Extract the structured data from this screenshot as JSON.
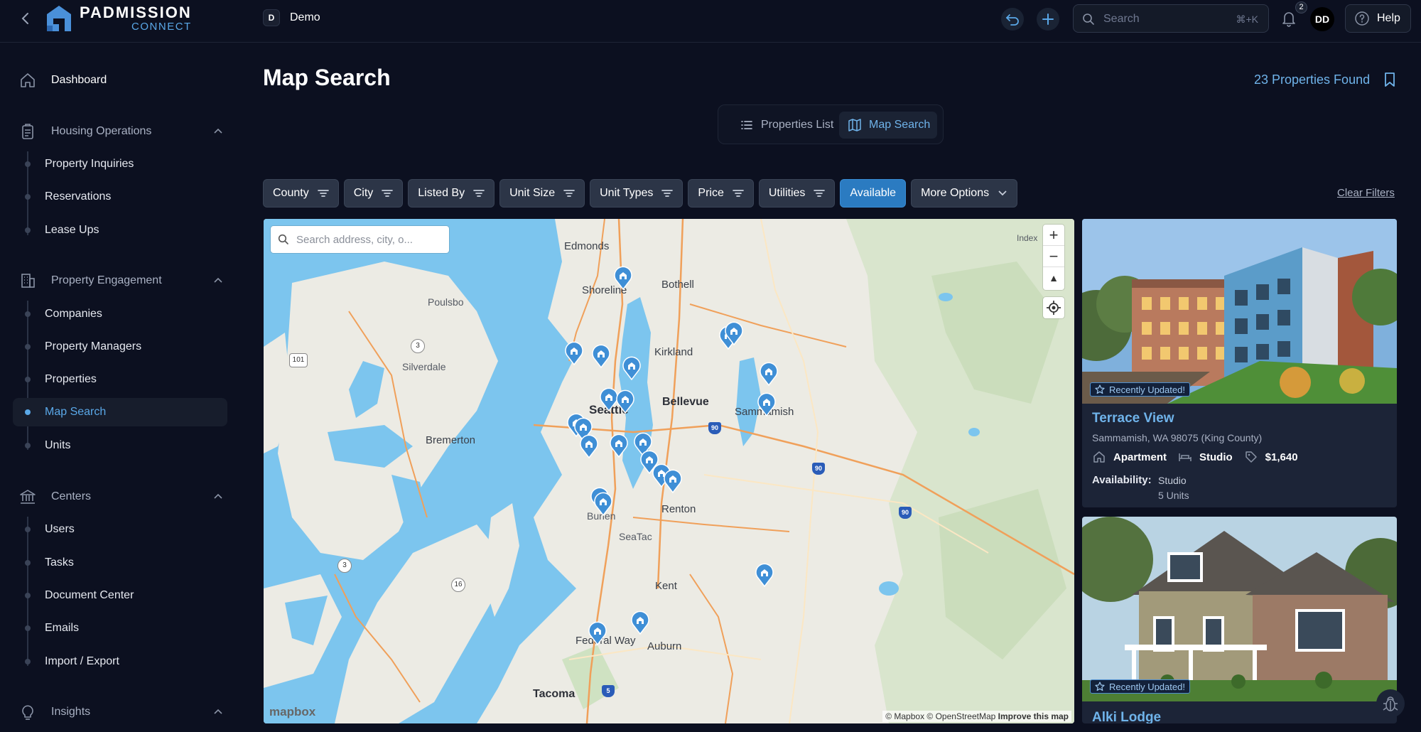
{
  "header": {
    "logo_title": "PADMISSION",
    "logo_subtitle": "CONNECT",
    "org_initial": "D",
    "org_name": "Demo",
    "search_placeholder": "Search",
    "search_shortcut": "⌘+K",
    "notification_count": "2",
    "avatar_initials": "DD",
    "help_label": "Help"
  },
  "sidebar": {
    "dashboard": "Dashboard",
    "sections": [
      {
        "label": "Housing Operations",
        "items": [
          "Property Inquiries",
          "Reservations",
          "Lease Ups"
        ]
      },
      {
        "label": "Property Engagement",
        "items": [
          "Companies",
          "Property Managers",
          "Properties",
          "Map Search",
          "Units"
        ]
      },
      {
        "label": "Centers",
        "items": [
          "Users",
          "Tasks",
          "Document Center",
          "Emails",
          "Import / Export"
        ]
      },
      {
        "label": "Insights",
        "items": []
      }
    ],
    "active_item": "Map Search"
  },
  "main": {
    "title": "Map Search",
    "properties_found": "23 Properties Found",
    "view_toggle": {
      "list": "Properties List",
      "map": "Map Search",
      "selected": "Map Search"
    },
    "filters": [
      "County",
      "City",
      "Listed By",
      "Unit Size",
      "Unit Types",
      "Price",
      "Utilities"
    ],
    "available_filter": "Available",
    "more_options": "More Options",
    "clear_filters": "Clear Filters"
  },
  "map": {
    "search_placeholder": "Search address, city, o...",
    "places": {
      "edmonds": "Edmonds",
      "shoreline": "Shoreline",
      "bothell": "Bothell",
      "poulsbo": "Poulsbo",
      "kirkland": "Kirkland",
      "silverdale": "Silverdale",
      "seattle": "Seattle",
      "bellevue": "Bellevue",
      "sammamish": "Sammamish",
      "bremerton": "Bremerton",
      "renton": "Renton",
      "burien": "Burien",
      "seatac": "SeaTac",
      "kent": "Kent",
      "federal_way": "Federal Way",
      "auburn": "Auburn",
      "tacoma": "Tacoma",
      "index": "Index"
    },
    "highways": {
      "sr3a": "3",
      "sr3b": "3",
      "us101": "101",
      "sr16": "16",
      "i90a": "90",
      "i90b": "90",
      "i90c": "90",
      "i5": "5"
    },
    "logo": "mapbox",
    "attribution": "© Mapbox © OpenStreetMap",
    "improve_link": "Improve this map"
  },
  "listings": [
    {
      "badge": "Recently Updated!",
      "name": "Terrace View",
      "address": "Sammamish, WA 98075 (King County)",
      "type": "Apartment",
      "size": "Studio",
      "price": "$1,640",
      "availability_label": "Availability:",
      "availability_type": "Studio",
      "availability_units": "5 Units"
    },
    {
      "badge": "Recently Updated!",
      "name": "Alki Lodge"
    }
  ],
  "colors": {
    "background": "#0c1020",
    "accent": "#6fb3ea",
    "available_chip": "#2b7bc1",
    "card": "#1c2437"
  }
}
